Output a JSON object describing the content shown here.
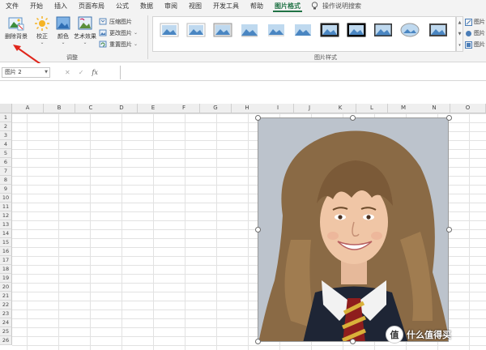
{
  "menu": {
    "items": [
      "文件",
      "开始",
      "插入",
      "页面布局",
      "公式",
      "数据",
      "审阅",
      "视图",
      "开发工具",
      "帮助",
      "图片格式"
    ],
    "active_index": 10,
    "tell_me": "操作说明搜索"
  },
  "ribbon": {
    "remove_bg": "删除背景",
    "corrections": "校正",
    "color": "颜色",
    "artistic": "艺术效果",
    "compress": "压缩图片",
    "change": "更改图片",
    "reset": "重置图片",
    "adjust_group": "调整",
    "styles_group": "图片样式",
    "right_tools": [
      "图片",
      "图片",
      "图片"
    ]
  },
  "formula_bar": {
    "name_box": "图片 2",
    "cancel": "✕",
    "enter": "✓",
    "fx": "fx",
    "value": ""
  },
  "grid": {
    "columns": [
      "A",
      "B",
      "C",
      "D",
      "E",
      "F",
      "G",
      "H",
      "I",
      "J",
      "K",
      "L",
      "M",
      "N",
      "O"
    ],
    "rows": [
      "1",
      "2",
      "3",
      "4",
      "5",
      "6",
      "7",
      "8",
      "9",
      "10",
      "11",
      "12",
      "13",
      "14",
      "15",
      "16",
      "17",
      "18",
      "19",
      "20",
      "21",
      "22",
      "23",
      "24",
      "25",
      "26"
    ]
  },
  "watermark": {
    "badge": "值",
    "text": "什么值得买"
  },
  "colors": {
    "accent": "#217346",
    "arrow": "#e0261c"
  }
}
